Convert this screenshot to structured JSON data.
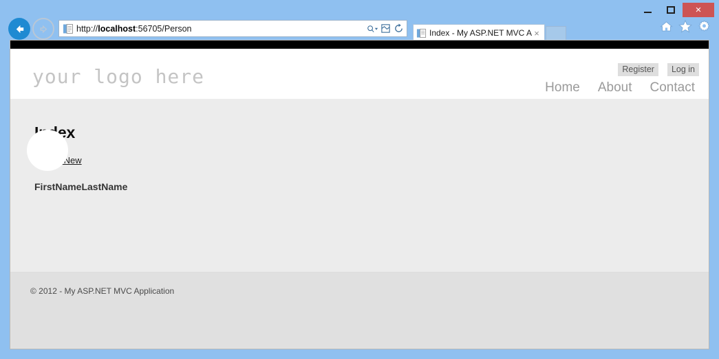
{
  "window": {
    "minimize_label": "Minimize",
    "maximize_label": "Maximize",
    "close_label": "×"
  },
  "browser": {
    "back_label": "Back",
    "forward_label": "Forward",
    "address": {
      "scheme": "http://",
      "host": "localhost",
      "rest": ":56705/Person",
      "full": "http://localhost:56705/Person"
    },
    "address_icons": [
      {
        "name": "search-dropdown-icon",
        "label": "Search"
      },
      {
        "name": "compatibility-view-icon",
        "label": "Compatibility View"
      },
      {
        "name": "refresh-icon",
        "label": "Refresh"
      }
    ],
    "tab": {
      "title": "Index - My ASP.NET MVC A...",
      "close_label": "×"
    },
    "toolbar_icons": [
      {
        "name": "home-icon",
        "label": "Home"
      },
      {
        "name": "favorites-icon",
        "label": "Favorites"
      },
      {
        "name": "tools-icon",
        "label": "Tools"
      }
    ]
  },
  "page": {
    "logo_text": "your logo here",
    "auth_links": [
      {
        "label": "Register"
      },
      {
        "label": "Log in"
      }
    ],
    "nav_links": [
      {
        "label": "Home"
      },
      {
        "label": "About"
      },
      {
        "label": "Contact"
      }
    ],
    "title": "Index",
    "create_link": "Create New",
    "table": {
      "columns": [
        "FirstName",
        "LastName"
      ],
      "rows": []
    },
    "footer": "© 2012 - My ASP.NET MVC Application"
  },
  "colors": {
    "chrome_blue": "#8fc0f0",
    "back_button_blue": "#1f8ad2",
    "close_button_red": "#cd5454",
    "page_bg": "#ececec",
    "footer_bg": "#e0e0e0",
    "topbar_black": "#000000"
  }
}
